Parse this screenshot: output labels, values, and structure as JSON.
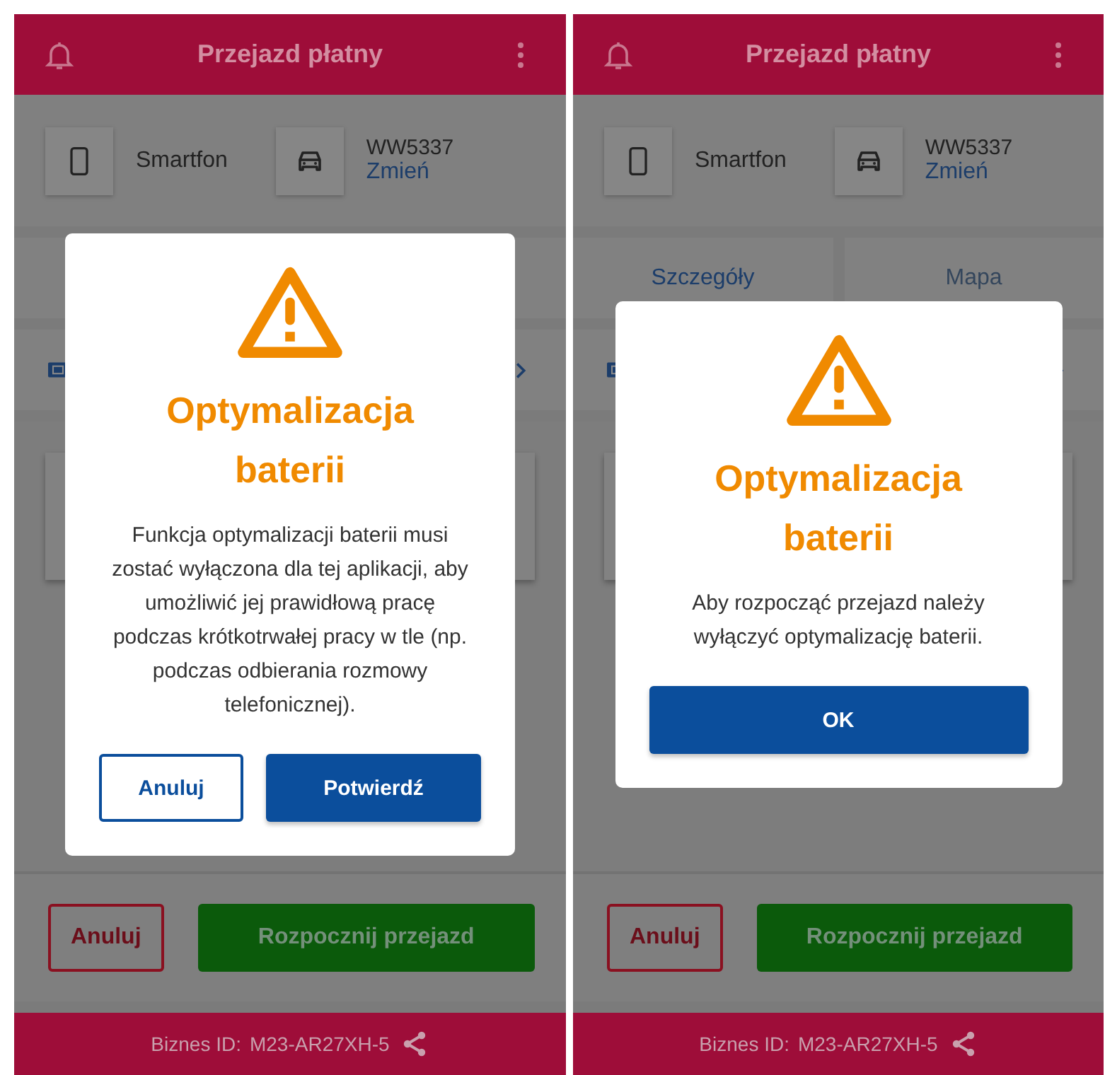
{
  "screens": [
    {
      "header": {
        "title": "Przejazd płatny"
      },
      "device": {
        "label": "Smartfon"
      },
      "vehicle": {
        "plate": "WW5337",
        "change_link": "Zmień"
      },
      "bottom_buttons": [
        {
          "label": "Anuluj",
          "kind": "outline"
        },
        {
          "label": "Rozpocznij przejazd",
          "kind": "primary"
        }
      ],
      "footer": {
        "label": "Biznes ID:",
        "value": "M23-AR27XH-5"
      },
      "dialog": {
        "title": "Optymalizacja baterii",
        "message": "Funkcja optymalizacji baterii musi zostać wyłączona dla tej aplikacji, aby umożliwić jej prawidłową pracę podczas krótkotrwałej pracy w tle (np. podczas odbierania rozmowy telefonicznej).",
        "buttons": [
          {
            "label": "Anuluj",
            "kind": "outline"
          },
          {
            "label": "Potwierdź",
            "kind": "primary"
          }
        ]
      }
    },
    {
      "header": {
        "title": "Przejazd płatny"
      },
      "device": {
        "label": "Smartfon"
      },
      "vehicle": {
        "plate": "WW5337",
        "change_link": "Zmień"
      },
      "tabs": [
        {
          "label": "Szczegóły",
          "selected": true
        },
        {
          "label": "Mapa",
          "selected": false
        }
      ],
      "bottom_buttons": [
        {
          "label": "Anuluj",
          "kind": "outline"
        },
        {
          "label": "Rozpocznij przejazd",
          "kind": "primary"
        }
      ],
      "footer": {
        "label": "Biznes ID:",
        "value": "M23-AR27XH-5"
      },
      "dialog": {
        "title": "Optymalizacja baterii",
        "message": "Aby rozpocząć przejazd należy wyłączyć optymalizację baterii.",
        "buttons": [
          {
            "label": "OK",
            "kind": "wide"
          }
        ]
      }
    }
  ]
}
